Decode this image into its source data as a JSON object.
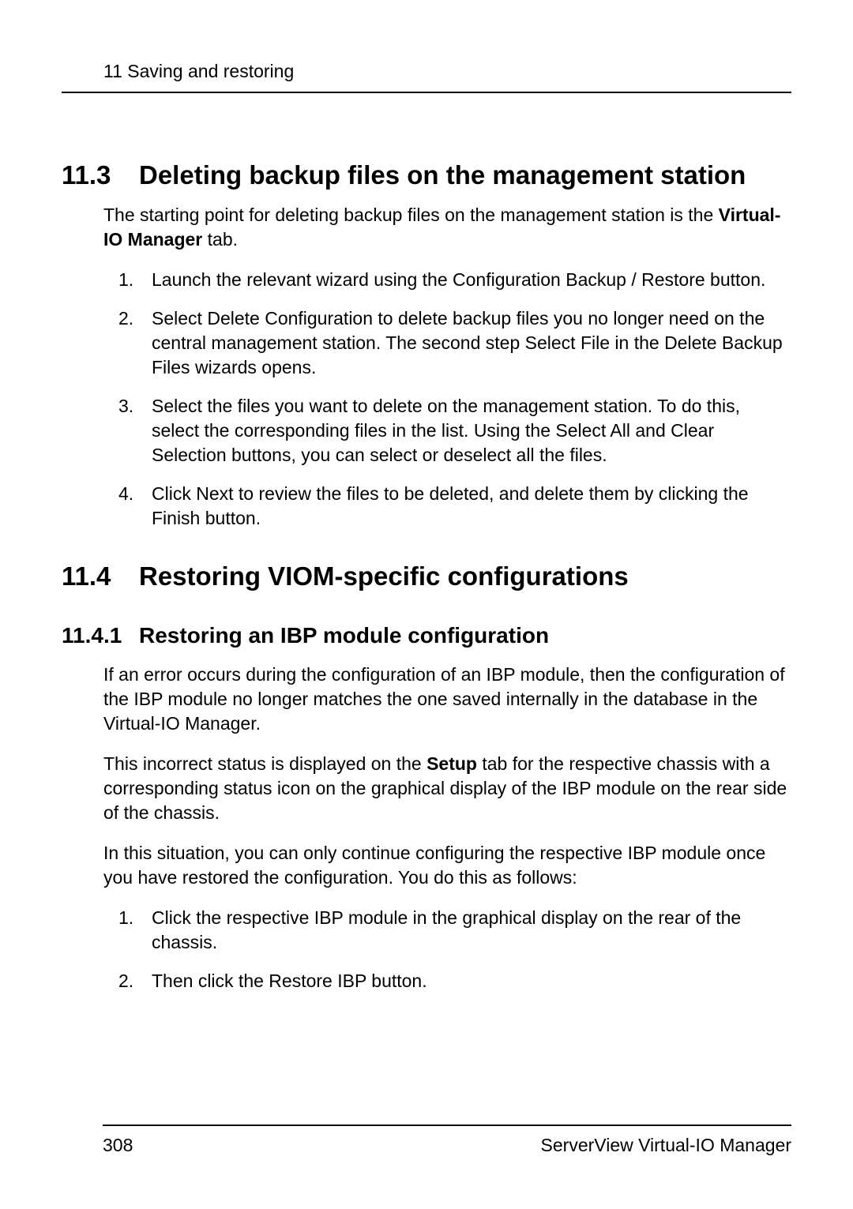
{
  "header": {
    "running": "11 Saving and restoring"
  },
  "s113": {
    "num": "11.3",
    "title": "Deleting backup files on the management station",
    "intro_pre": "The starting point for deleting backup files on the management station is the ",
    "intro_bold": "Virtual-IO Manager",
    "intro_post": " tab.",
    "step1_pre": "Launch the relevant wizard using the ",
    "step1_bold": "Configuration Backup / Restore",
    "step1_post": " button.",
    "step2_s1": "Select ",
    "step2_b1": "Delete Configuration",
    "step2_s2": " to delete backup files you no longer need on the central management station. The second step ",
    "step2_b2": "Select File",
    "step2_s3": " in the ",
    "step2_b3": "Delete Backup Files",
    "step2_s4": " wizards opens.",
    "step3_s1": "Select the files you want to delete on the management station. To do this, select the corresponding files in the list. Using the ",
    "step3_b1": "Select All",
    "step3_s2": " and ",
    "step3_b2": "Clear Selection",
    "step3_s3": " buttons, you can select or deselect all the files.",
    "step4_s1": "Click ",
    "step4_b1": "Next",
    "step4_s2": " to review the files to be deleted, and delete them by clicking the ",
    "step4_b2": "Finish",
    "step4_s3": " button."
  },
  "s114": {
    "num": "11.4",
    "title": "Restoring VIOM-specific configurations"
  },
  "s1141": {
    "num": "11.4.1",
    "title": "Restoring an IBP module configuration",
    "p1": "If an error occurs during the configuration of an IBP module, then the configuration of the IBP module no longer matches the one saved internally in the database in the Virtual-IO Manager.",
    "p2_s1": "This incorrect status is displayed on the ",
    "p2_b1": "Setup",
    "p2_s2": " tab for the respective chassis with a corresponding status icon on the graphical display of the IBP module on the rear side of the chassis.",
    "p3": "In this situation, you can only continue configuring the respective IBP module once you have restored the configuration. You do this as follows:",
    "step1": "Click the respective IBP module in the graphical display on the rear of the chassis.",
    "step2_s1": "Then click the ",
    "step2_b1": "Restore IBP",
    "step2_s2": " button."
  },
  "footer": {
    "page": "308",
    "doc": "ServerView Virtual-IO Manager"
  },
  "nums": {
    "n1": "1.",
    "n2": "2.",
    "n3": "3.",
    "n4": "4."
  }
}
